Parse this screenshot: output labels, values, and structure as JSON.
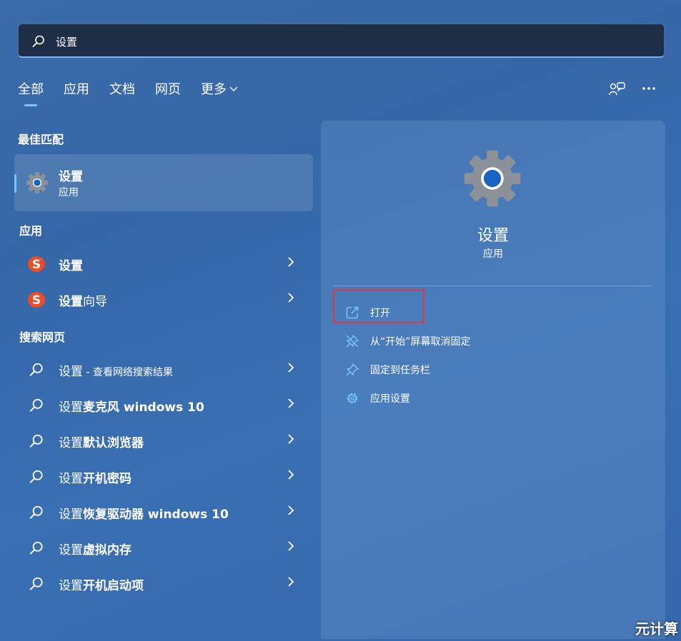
{
  "search": {
    "value": "设置"
  },
  "tabs": [
    {
      "label": "全部",
      "active": true
    },
    {
      "label": "应用"
    },
    {
      "label": "文档"
    },
    {
      "label": "网页"
    },
    {
      "label": "更多"
    }
  ],
  "top_icons": [
    "feedback-icon",
    "more-icon"
  ],
  "best_match": {
    "section_label": "最佳匹配",
    "title": "设置",
    "subtitle": "应用",
    "icon": "gear-icon"
  },
  "apps": {
    "section_label": "应用",
    "items": [
      {
        "label": "设置",
        "icon": "sogou-icon"
      },
      {
        "label_bold": "设置",
        "label_rest": "向导",
        "icon": "sogou-icon"
      }
    ]
  },
  "web": {
    "section_label": "搜索网页",
    "items": [
      {
        "prefix": "设置",
        "suffix": " - 查看网络搜索结果"
      },
      {
        "prefix": "设置",
        "suffix": "麦克风 windows 10"
      },
      {
        "prefix": "设置",
        "suffix": "默认浏览器"
      },
      {
        "prefix": "设置",
        "suffix": "开机密码"
      },
      {
        "prefix": "设置",
        "suffix": "恢复驱动器 windows 10"
      },
      {
        "prefix": "设置",
        "suffix": "虚拟内存"
      },
      {
        "prefix": "设置",
        "suffix": "开机启动项"
      }
    ]
  },
  "preview": {
    "title": "设置",
    "subtitle": "应用",
    "actions": [
      {
        "label": "打开",
        "icon": "open-external-icon"
      },
      {
        "label": "从“开始”屏幕取消固定",
        "icon": "unpin-icon"
      },
      {
        "label": "固定到任务栏",
        "icon": "pin-icon"
      },
      {
        "label": "应用设置",
        "icon": "gear-icon"
      }
    ]
  },
  "watermark": "元计算",
  "colors": {
    "accent": "#7cc4ff",
    "highlight_box": "#e0383d",
    "sogou": "#f04b24"
  }
}
